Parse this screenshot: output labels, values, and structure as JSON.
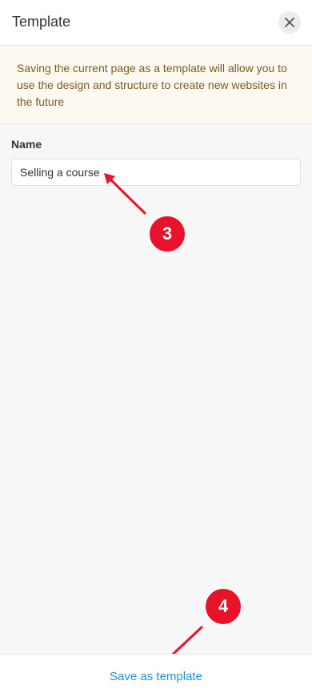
{
  "header": {
    "title": "Template",
    "close_icon": "close-icon"
  },
  "notice": {
    "text": "Saving the current page as a template will allow you to use the design and structure to create new websites in the future"
  },
  "form": {
    "name_label": "Name",
    "name_value": "Selling a course"
  },
  "annotations": {
    "step_3": "3",
    "step_4": "4",
    "color": "#e8122b"
  },
  "footer": {
    "save_label": "Save as template",
    "accent": "#2c8ed6"
  }
}
